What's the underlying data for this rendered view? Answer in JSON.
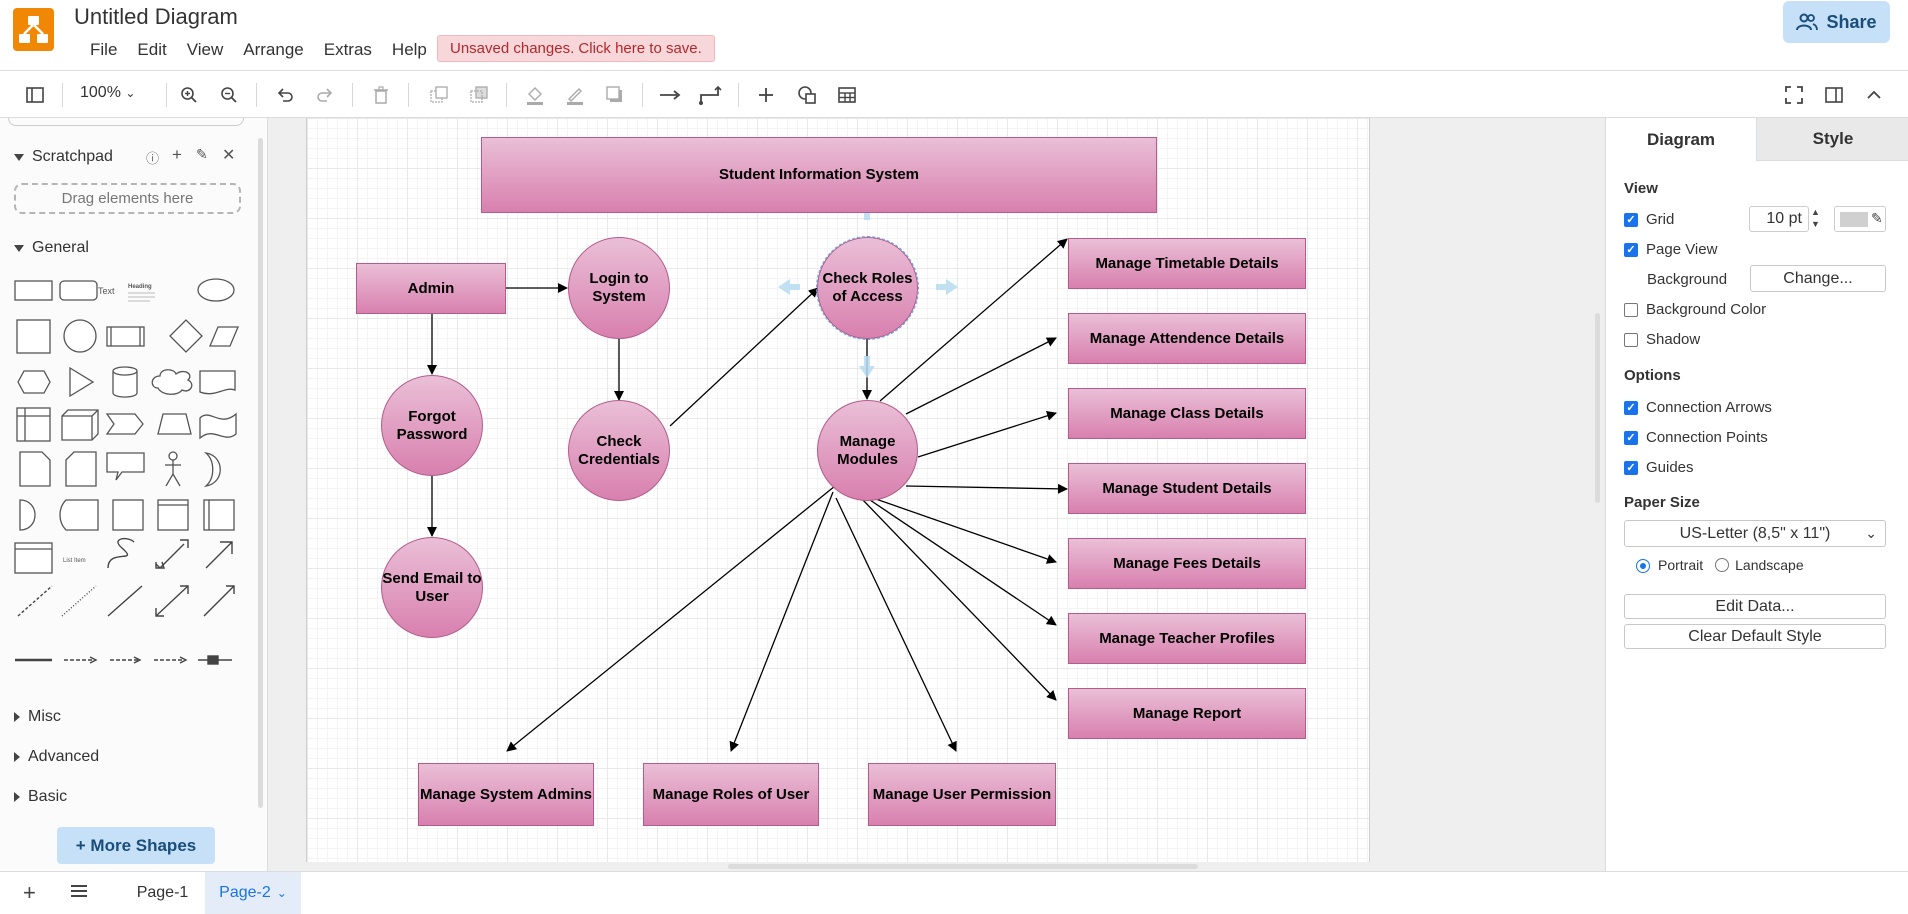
{
  "app": {
    "title": "Untitled Diagram",
    "brand_color": "#f08705"
  },
  "menu": [
    "File",
    "Edit",
    "View",
    "Arrange",
    "Extras",
    "Help"
  ],
  "unsaved": "Unsaved changes. Click here to save.",
  "share": {
    "label": "Share"
  },
  "toolbar": {
    "zoom": "100%"
  },
  "left": {
    "scratchpad": "Scratchpad",
    "drag_here": "Drag elements here",
    "general": "General",
    "misc": "Misc",
    "advanced": "Advanced",
    "basic": "Basic",
    "more_shapes": "+ More Shapes",
    "shape_text": "Text",
    "shape_heading": "Heading",
    "shape_listitem": "List Item"
  },
  "diagram": {
    "title": "Student Information System",
    "nodes": {
      "admin": "Admin",
      "login": "Login to System",
      "check_roles": "Check Roles of Access",
      "forgot": "Forgot Password",
      "check_cred": "Check Credentials",
      "manage_modules": "Manage Modules",
      "send_email": "Send Email to User",
      "timetable": "Manage Timetable Details",
      "attendance": "Manage Attendence Details",
      "class": "Manage Class Details",
      "student": "Manage Student Details",
      "fees": "Manage Fees Details",
      "teacher": "Manage Teacher Profiles",
      "report": "Manage Report",
      "sys_admins": "Manage System Admins",
      "roles_user": "Manage Roles of User",
      "user_perm": "Manage User Permission"
    }
  },
  "right": {
    "tab_diagram": "Diagram",
    "tab_style": "Style",
    "view": "View",
    "grid": "Grid",
    "grid_size": "10 pt",
    "page_view": "Page View",
    "background": "Background",
    "change": "Change...",
    "bg_color": "Background Color",
    "shadow": "Shadow",
    "options": "Options",
    "conn_arrows": "Connection Arrows",
    "conn_points": "Connection Points",
    "guides": "Guides",
    "paper_size": "Paper Size",
    "paper_value": "US-Letter (8,5\" x 11\")",
    "portrait": "Portrait",
    "landscape": "Landscape",
    "edit_data": "Edit Data...",
    "clear_style": "Clear Default Style"
  },
  "footer": {
    "pages": [
      "Page-1",
      "Page-2"
    ]
  }
}
